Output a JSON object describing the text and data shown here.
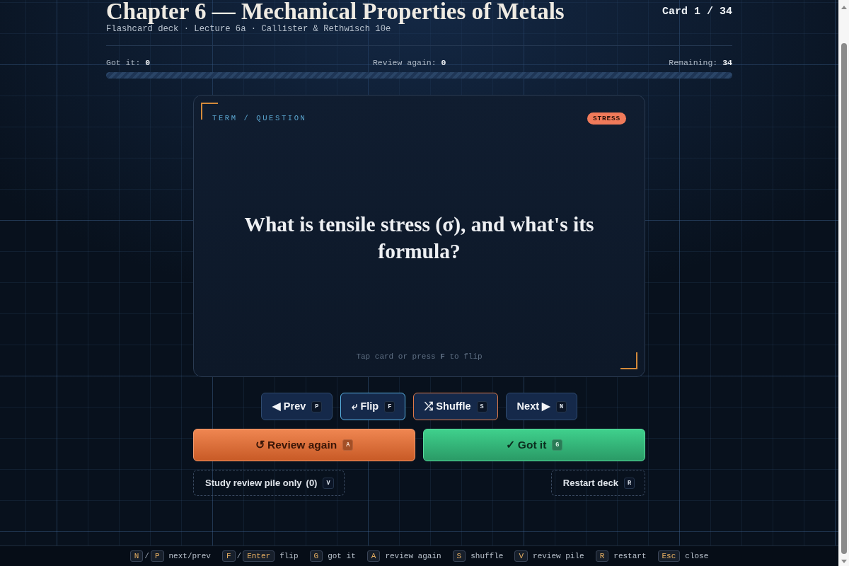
{
  "header": {
    "title": "Chapter 6 — Mechanical Properties of Metals",
    "subtitle": "Flashcard deck · Lecture 6a · Callister & Rethwisch 10e",
    "counter": "Card 1 / 34"
  },
  "stats": [
    "Got it: **0**",
    "Review again: **0**",
    "Remaining: **34**"
  ],
  "progress": {
    "level": 0
  },
  "card": {
    "side_label": "TERM / QUESTION",
    "tag": "STRESS",
    "question": "What is tensile stress (σ), and what's its formula?",
    "hint": "Tap card or press **F** to flip"
  },
  "nav_buttons": [
    {
      "kind": "prev",
      "label": "◀ Prev",
      "key": "P"
    },
    {
      "kind": "flip",
      "label": "⤶ Flip",
      "key": "F"
    },
    {
      "kind": "shuffle",
      "label": "⤮ Shuffle",
      "key": "S"
    },
    {
      "kind": "next",
      "label": "Next ▶",
      "key": "N"
    }
  ],
  "grade_buttons": [
    {
      "kind": "review",
      "label": "↺ Review again",
      "key": "A"
    },
    {
      "kind": "got",
      "label": "✓ Got it",
      "key": "G"
    }
  ],
  "extra_buttons": [
    {
      "label": "Study review pile only",
      "count": "(0)",
      "key": "V"
    },
    {
      "label": "Restart deck",
      "key": "R"
    }
  ],
  "shortcuts": [
    {
      "parts": [
        {
          "kind": "key",
          "text": "N"
        },
        {
          "kind": "sep",
          "text": "/"
        },
        {
          "kind": "key",
          "text": "P"
        },
        {
          "kind": "label",
          "text": "next/prev"
        }
      ]
    },
    {
      "parts": [
        {
          "kind": "key",
          "text": "F"
        },
        {
          "kind": "sep",
          "text": "/"
        },
        {
          "kind": "key",
          "text": "Enter"
        },
        {
          "kind": "label",
          "text": "flip"
        }
      ]
    },
    {
      "parts": [
        {
          "kind": "key",
          "text": "G"
        },
        {
          "kind": "label",
          "text": "got it"
        }
      ]
    },
    {
      "parts": [
        {
          "kind": "key",
          "text": "A"
        },
        {
          "kind": "label",
          "text": "review again"
        }
      ]
    },
    {
      "parts": [
        {
          "kind": "key",
          "text": "S"
        },
        {
          "kind": "label",
          "text": "shuffle"
        }
      ]
    },
    {
      "parts": [
        {
          "kind": "key",
          "text": "V"
        },
        {
          "kind": "label",
          "text": "review pile"
        }
      ]
    },
    {
      "parts": [
        {
          "kind": "key",
          "text": "R"
        },
        {
          "kind": "label",
          "text": "restart"
        }
      ]
    },
    {
      "parts": [
        {
          "kind": "key",
          "text": "Esc"
        },
        {
          "kind": "label",
          "text": "close"
        }
      ]
    }
  ]
}
